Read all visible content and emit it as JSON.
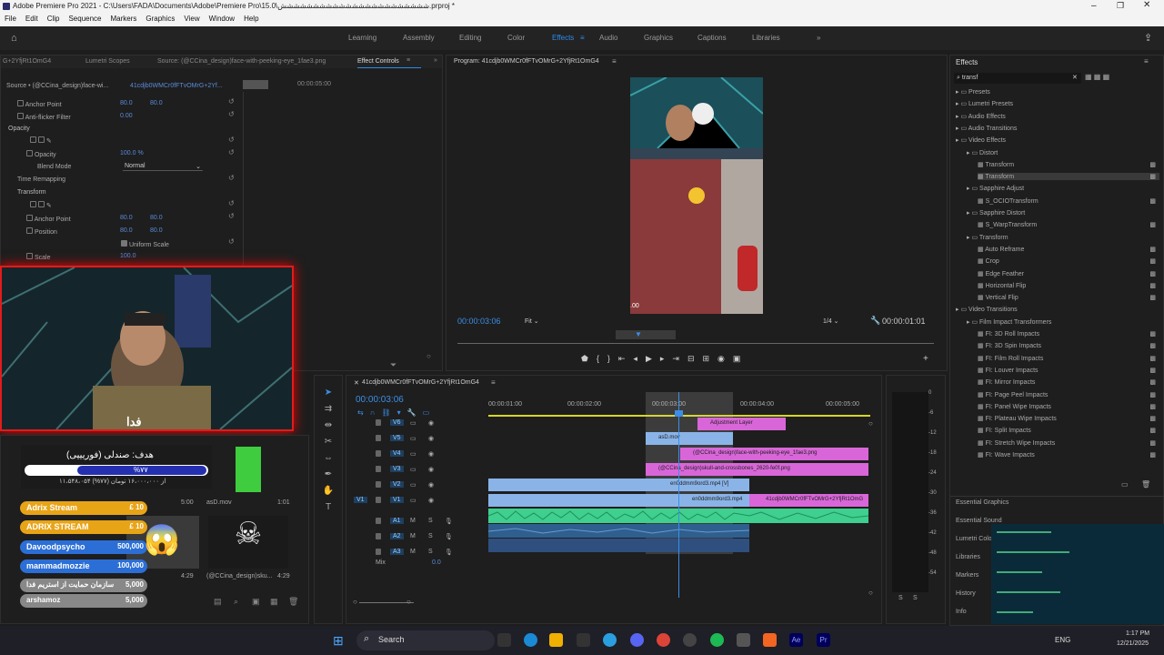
{
  "window": {
    "title": "Adobe Premiere Pro 2021 - C:\\Users\\FADA\\Documents\\Adobe\\Premiere Pro\\15.0\\ششششششششششششششششششششششش.prproj *"
  },
  "menu": [
    "File",
    "Edit",
    "Clip",
    "Sequence",
    "Markers",
    "Graphics",
    "View",
    "Window",
    "Help"
  ],
  "workspaces": [
    "Learning",
    "Assembly",
    "Editing",
    "Color",
    "Effects",
    "Audio",
    "Graphics",
    "Captions",
    "Libraries"
  ],
  "active_workspace": "Effects",
  "effect_controls": {
    "tabs": [
      "G+2YfjRt1OmG4",
      "Lumetri Scopes",
      "Source: (@CCina_design)face-with-peeking-eye_1fae3.png",
      "Effect Controls"
    ],
    "source_label": "Source • (@CCina_design)face-wi...",
    "clip_label": "41cdjb0WMCr0fFTvOMrG+2Yf...",
    "timecode": "00:00:05:00",
    "rows": [
      {
        "name": "Anchor Point",
        "v1": "80.0",
        "v2": "80.0"
      },
      {
        "name": "Anti-flicker Filter",
        "v1": "0.00",
        "v2": ""
      },
      {
        "name": "Opacity",
        "v1": "",
        "v2": ""
      },
      {
        "name": "Opacity",
        "v1": "100.0 %",
        "v2": ""
      },
      {
        "name": "Blend Mode",
        "v1": "Normal",
        "v2": ""
      },
      {
        "name": "Time Remapping",
        "v1": "",
        "v2": ""
      },
      {
        "name": "Transform",
        "v1": "",
        "v2": ""
      },
      {
        "name": "Anchor Point",
        "v1": "80.0",
        "v2": "80.0"
      },
      {
        "name": "Position",
        "v1": "80.0",
        "v2": "80.0"
      },
      {
        "name": "Uniform Scale",
        "v1": "",
        "v2": ""
      },
      {
        "name": "Scale",
        "v1": "100.0",
        "v2": ""
      }
    ]
  },
  "program": {
    "title": "Program: 41cdjb0WMCr0fFTvOMrG+2YfjRt1OmG4",
    "timecode": "00:00:03:06",
    "fit": "Fit",
    "quality": "1/4",
    "duration": "00:00:01:01",
    "frame_label": ".00"
  },
  "effects_panel": {
    "title": "Effects",
    "search": "transf",
    "items": [
      {
        "label": "Presets",
        "level": 0
      },
      {
        "label": "Lumetri Presets",
        "level": 0
      },
      {
        "label": "Audio Effects",
        "level": 0
      },
      {
        "label": "Audio Transitions",
        "level": 0
      },
      {
        "label": "Video Effects",
        "level": 0
      },
      {
        "label": "Distort",
        "level": 1
      },
      {
        "label": "Transform",
        "level": 2
      },
      {
        "label": "Transform",
        "level": 2
      },
      {
        "label": "Sapphire Adjust",
        "level": 1
      },
      {
        "label": "S_OCIOTransform",
        "level": 2
      },
      {
        "label": "Sapphire Distort",
        "level": 1
      },
      {
        "label": "S_WarpTransform",
        "level": 2
      },
      {
        "label": "Transform",
        "level": 1
      },
      {
        "label": "Auto Reframe",
        "level": 2
      },
      {
        "label": "Crop",
        "level": 2
      },
      {
        "label": "Edge Feather",
        "level": 2
      },
      {
        "label": "Horizontal Flip",
        "level": 2
      },
      {
        "label": "Vertical Flip",
        "level": 2
      },
      {
        "label": "Video Transitions",
        "level": 0
      },
      {
        "label": "Film Impact Transformers",
        "level": 1
      },
      {
        "label": "FI: 3D Roll Impacts",
        "level": 2
      },
      {
        "label": "FI: 3D Spin Impacts",
        "level": 2
      },
      {
        "label": "FI: Film Roll Impacts",
        "level": 2
      },
      {
        "label": "FI: Louver Impacts",
        "level": 2
      },
      {
        "label": "FI: Mirror Impacts",
        "level": 2
      },
      {
        "label": "FI: Page Peel Impacts",
        "level": 2
      },
      {
        "label": "FI: Panel Wipe Impacts",
        "level": 2
      },
      {
        "label": "FI: Plateau Wipe Impacts",
        "level": 2
      },
      {
        "label": "FI: Split Impacts",
        "level": 2
      },
      {
        "label": "FI: Stretch Wipe Impacts",
        "level": 2
      },
      {
        "label": "FI: Wave Impacts",
        "level": 2
      }
    ],
    "lower": [
      "Essential Graphics",
      "Essential Sound",
      "Lumetri Color",
      "Libraries",
      "Markers",
      "History",
      "Info"
    ]
  },
  "timeline": {
    "title": "41cdjb0WMCr0fFTvOMrG+2YfjRt1OmG4",
    "timecode": "00:00:03:06",
    "ruler": [
      "00:00:01:00",
      "00:00:02:00",
      "00:00:03:00",
      "00:00:04:00",
      "00:00:05:00"
    ],
    "video_tracks": [
      "V6",
      "V5",
      "V4",
      "V3",
      "V2",
      "V1"
    ],
    "audio_tracks": [
      "A1",
      "A2",
      "A3"
    ],
    "mix_label": "Mix",
    "mix_value": "0.0",
    "clips": {
      "adjustment": "Adjustment Layer",
      "asd": "asD.mov",
      "face": "(@CCina_design)face-with-peeking-eye_1fae3.png",
      "skull": "(@CCina_design)skull-and-crossbones_2620-fe0f.png",
      "v2": "en0ddmm9ord3.mp4 [V]",
      "v1a": "en0ddmm9ord3.mp4",
      "v1b": "41cdjb0WMCr0fFTvOMrG+2YfjRt1OmG"
    },
    "meter_ticks": [
      "0",
      "-6",
      "-12",
      "-18",
      "-24",
      "-30",
      "-36",
      "-42",
      "-48",
      "-54"
    ],
    "meter_labels": [
      "S",
      "S"
    ]
  },
  "project": {
    "items": [
      {
        "label": "asD.mov",
        "duration": "1:01"
      },
      {
        "label": "(@CCina_design)sku...",
        "duration": "4:29"
      }
    ],
    "durations": [
      "5:00",
      "4:29"
    ]
  },
  "overlay": {
    "streamer_name": "فدا",
    "goal_title": "هدف: صندلی (فوریییی)",
    "goal_percent": "%۷۷",
    "goal_sub": "۱۱،۵۴۸،۰۵۴ از ۱۶،۰۰۰،۰۰۰ تومان (۷۷%)",
    "donors": [
      {
        "name": "Adrix Stream",
        "amount": "£ 10",
        "color": "#e8a417"
      },
      {
        "name": "ADRIX STREAM",
        "amount": "£ 10",
        "color": "#e8a417"
      },
      {
        "name": "Davoodpsycho",
        "amount": "500,000",
        "color": "#2b6fd6"
      },
      {
        "name": "mammadmozzie",
        "amount": "100,000",
        "color": "#2b6fd6"
      },
      {
        "name": "سازمان حمایت از استریم فدا",
        "amount": "5,000",
        "color": "#888888"
      },
      {
        "name": "arshamoz",
        "amount": "5,000",
        "color": "#888888"
      }
    ]
  },
  "taskbar": {
    "search": "Search",
    "lang": "ENG",
    "time": "1:17 PM",
    "date": "12/21/2025"
  },
  "colors": {
    "accent": "#2d8ceb",
    "clip_pink": "#d966d9",
    "clip_blue": "#8ab4e8",
    "audio_green": "#3fcf8e",
    "timecode": "#3d8ee6"
  }
}
